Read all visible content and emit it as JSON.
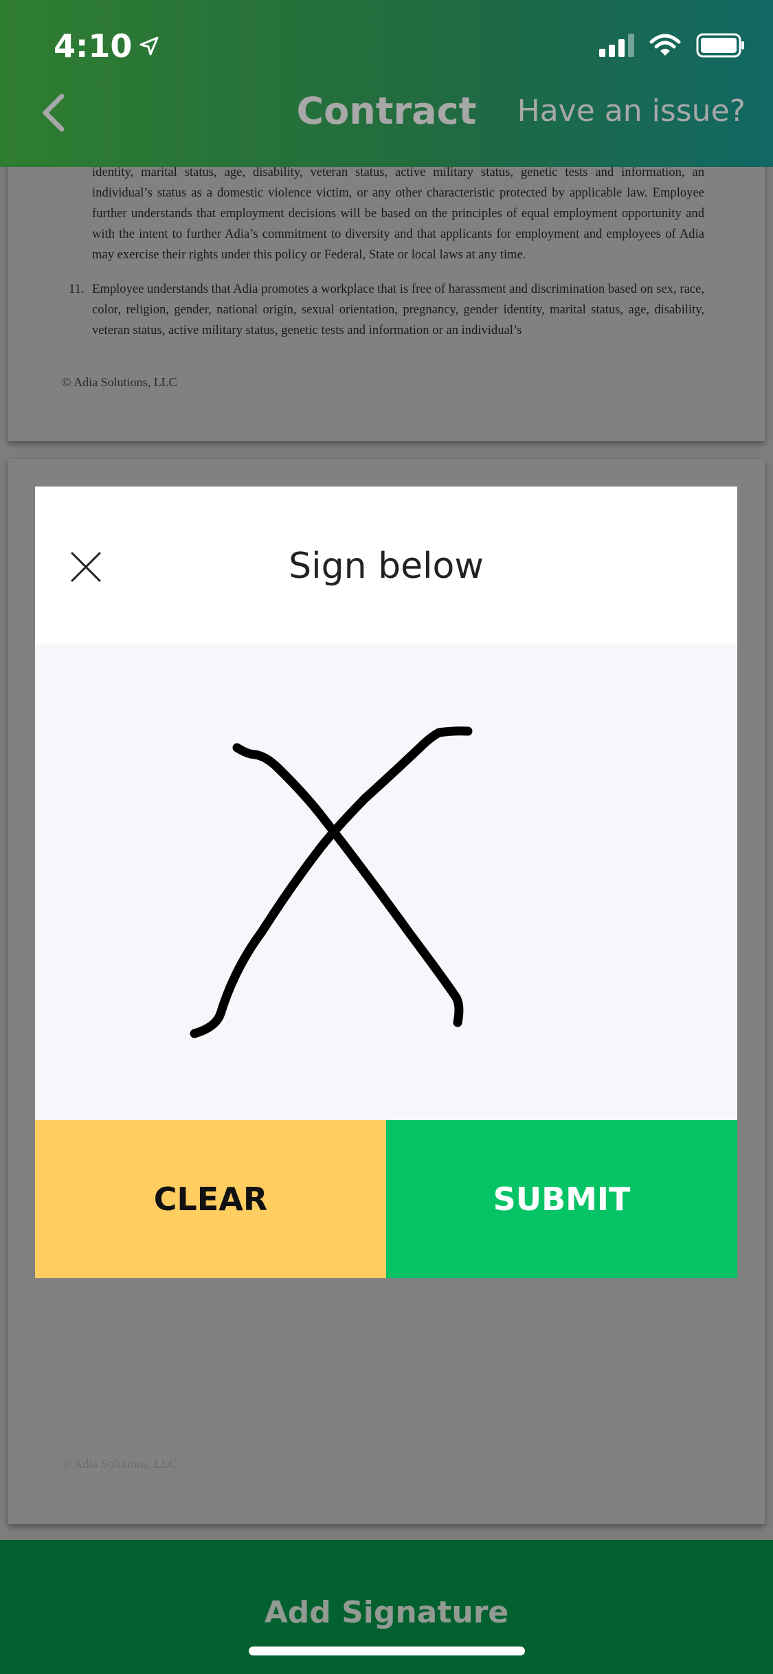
{
  "status_bar": {
    "time": "4:10",
    "icons": [
      "location-arrow-icon",
      "signal-icon",
      "wifi-icon",
      "battery-icon"
    ]
  },
  "header": {
    "back_icon": "chevron-left-icon",
    "title": "Contract",
    "issue_link": "Have an issue?"
  },
  "document": {
    "paragraph_continued": "identity, marital status, age, disability, veteran status, active military status, genetic tests and information, an individual’s status as a domestic violence victim, or any other characteristic protected by applicable law. Employee further understands that employment decisions will be based on the principles of equal employment opportunity and with the intent to further Adia’s commitment to diversity and that applicants for employment and employees of Adia may exercise their rights under this policy or Federal, State or local laws at any time.",
    "item_number": "11.",
    "item_text": "Employee understands that Adia promotes a workplace that is free of harassment and discrimination based on sex, race, color, religion, gender, national origin, sexual orientation, pregnancy, gender identity, marital status, age, disability, veteran status, active military status, genetic tests and information or an individual’s",
    "copyright_page1": "© Adia Solutions, LLC",
    "copyright_page2": "© Adia Solutions, LLC"
  },
  "modal": {
    "title": "Sign below",
    "close_icon": "close-icon",
    "clear_label": "CLEAR",
    "submit_label": "SUBMIT",
    "colors": {
      "clear": "#ffcd60",
      "submit": "#06c466",
      "canvas": "#f6f7fb"
    }
  },
  "bottom_bar": {
    "label": "Add Signature",
    "color": "#02612f"
  }
}
